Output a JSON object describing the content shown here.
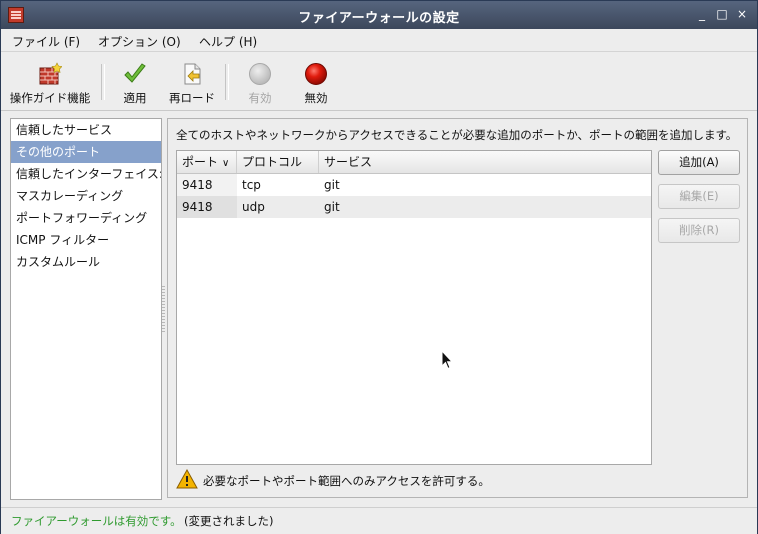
{
  "window": {
    "title": "ファイアーウォールの設定",
    "controls": [
      "_",
      "□",
      "×"
    ]
  },
  "menubar": {
    "items": [
      {
        "label": "ファイル (F)"
      },
      {
        "label": "オプション (O)"
      },
      {
        "label": "ヘルプ (H)"
      }
    ]
  },
  "toolbar": {
    "wizard_label": "操作ガイド機能",
    "apply_label": "適用",
    "reload_label": "再ロード",
    "enable_label": "有効",
    "disable_label": "無効"
  },
  "sidebar": {
    "items": [
      {
        "label": "信頼したサービス"
      },
      {
        "label": "その他のポート"
      },
      {
        "label": "信頼したインターフェイス:"
      },
      {
        "label": "マスカレーディング"
      },
      {
        "label": "ポートフォワーディング"
      },
      {
        "label": "ICMP フィルター"
      },
      {
        "label": "カスタムルール"
      }
    ],
    "selected_index": 1
  },
  "main": {
    "description": "全てのホストやネットワークからアクセスできることが必要な追加のポートか、ポートの範囲を追加します。",
    "columns": [
      "ポート",
      "プロトコル",
      "サービス"
    ],
    "rows": [
      {
        "port": "9418",
        "protocol": "tcp",
        "service": "git"
      },
      {
        "port": "9418",
        "protocol": "udp",
        "service": "git"
      }
    ],
    "buttons": {
      "add": "追加(A)",
      "edit": "編集(E)",
      "delete": "削除(R)"
    },
    "warning": "必要なポートやポート範囲へのみアクセスを許可する。"
  },
  "status": {
    "state": "ファイアーウォールは有効です。",
    "note": "(変更されました)"
  },
  "colors": {
    "selection": "#86a1cb",
    "status_ok": "#2e9a2e",
    "title_bar": "#4a5569"
  }
}
